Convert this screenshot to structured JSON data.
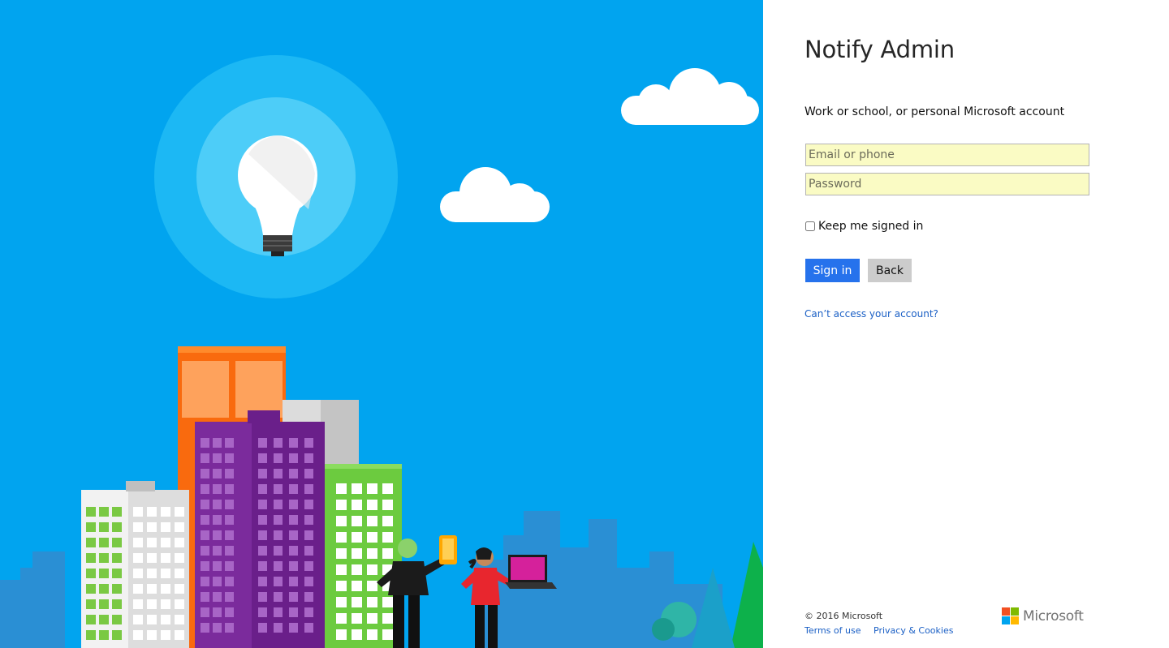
{
  "login": {
    "title": "Notify Admin",
    "prompt": "Work or school, or personal Microsoft account",
    "email_placeholder": "Email or phone",
    "password_placeholder": "Password",
    "keep_signed_in_label": "Keep me signed in",
    "keep_signed_in_checked": false,
    "sign_in_label": "Sign in",
    "back_label": "Back",
    "cant_access_label": "Can’t access your account?"
  },
  "footer": {
    "copyright": "© 2016 Microsoft",
    "terms_label": "Terms of use",
    "privacy_label": "Privacy & Cookies",
    "brand_name": "Microsoft",
    "brand_colors": [
      "#f25022",
      "#7fba00",
      "#00a4ef",
      "#ffb900"
    ]
  },
  "theme": {
    "sky": "#01a4ef",
    "sign_in_button": "#2672ec",
    "back_button": "#cccccc",
    "input_fill": "#fafbc4",
    "link": "#1a5fc5"
  },
  "illustration": {
    "icons": [
      "lightbulb-icon",
      "cloud-icon",
      "city-buildings",
      "person-with-phone",
      "person-with-laptop",
      "tree-icon"
    ]
  }
}
